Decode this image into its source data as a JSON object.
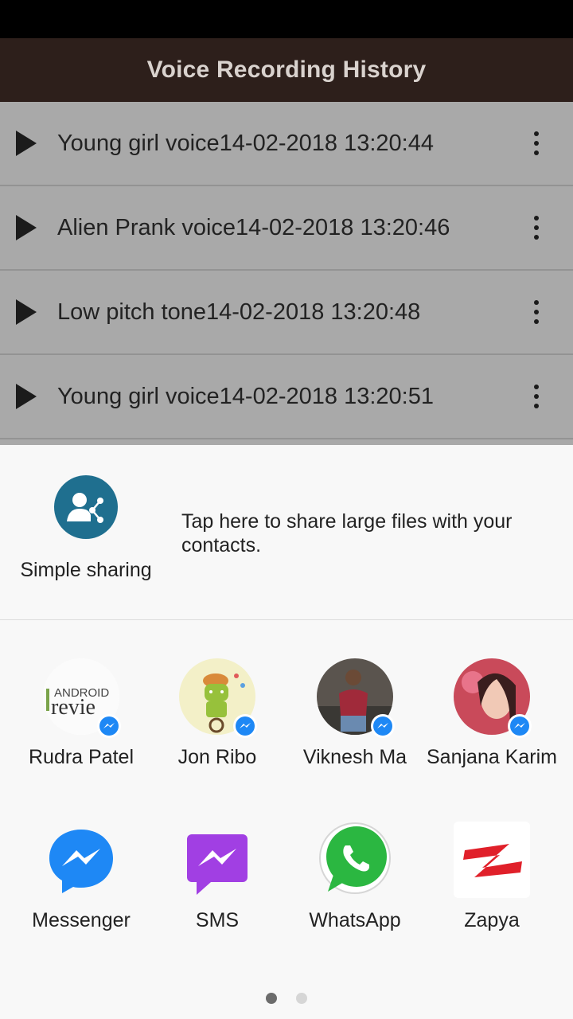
{
  "app_bar": {
    "title": "Voice Recording History"
  },
  "recordings": [
    {
      "title": "Young girl voice14-02-2018 13:20:44"
    },
    {
      "title": "Alien Prank voice14-02-2018 13:20:46"
    },
    {
      "title": "Low pitch tone14-02-2018 13:20:48"
    },
    {
      "title": "Young girl voice14-02-2018 13:20:51"
    }
  ],
  "share_sheet": {
    "simple_sharing": {
      "label": "Simple sharing",
      "description": "Tap here to share large files with your contacts."
    },
    "contacts": [
      {
        "name": "Rudra Patel",
        "badge_icon": "messenger-badge-icon"
      },
      {
        "name": "Jon Ribo",
        "badge_icon": "messenger-badge-icon"
      },
      {
        "name": "Viknesh Ma",
        "badge_icon": "messenger-badge-icon"
      },
      {
        "name": "Sanjana Karim",
        "badge_icon": "messenger-badge-icon"
      }
    ],
    "apps": [
      {
        "name": "Messenger",
        "icon": "messenger-icon",
        "color": "#1e88f5"
      },
      {
        "name": "SMS",
        "icon": "sms-icon",
        "color": "#a13fe3"
      },
      {
        "name": "WhatsApp",
        "icon": "whatsapp-icon",
        "color": "#2bb741"
      },
      {
        "name": "Zapya",
        "icon": "zapya-icon",
        "color": "#e0202a"
      }
    ],
    "page_indicator": {
      "pages": 2,
      "current": 1
    }
  },
  "colors": {
    "app_bar_bg": "#2d1f1b",
    "list_bg": "#a9a9a9",
    "sheet_bg": "#f8f8f8"
  }
}
